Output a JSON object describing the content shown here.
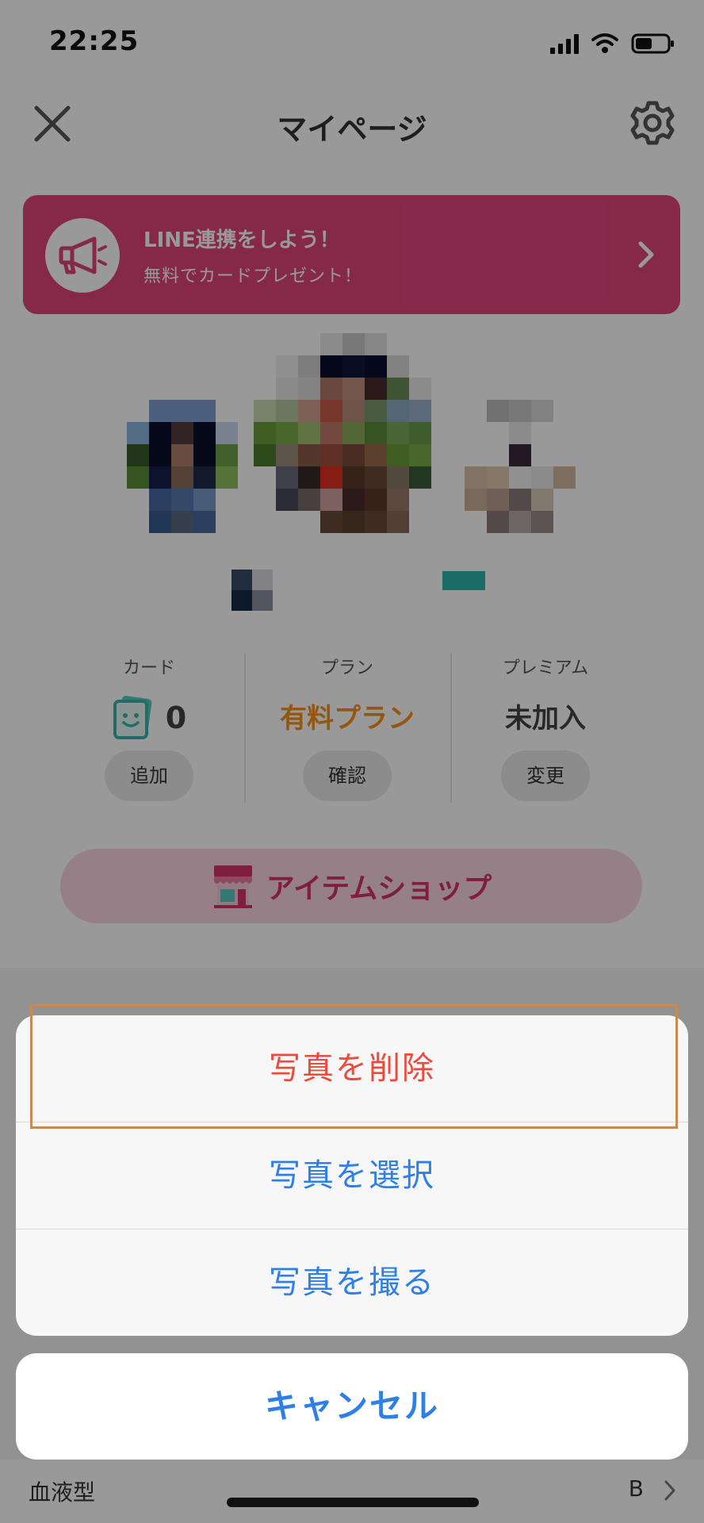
{
  "status_bar": {
    "time": "22:25"
  },
  "header": {
    "title": "マイページ",
    "close_icon": "close-icon",
    "settings_icon": "gear-icon"
  },
  "banner": {
    "title": "LINE連携をしよう！",
    "subtitle": "無料でカードプレゼント！",
    "icon": "megaphone-icon",
    "color": "#e0457b"
  },
  "stats": {
    "card": {
      "label": "カード",
      "value": "0",
      "button": "追加",
      "icon": "card-icon"
    },
    "plan": {
      "label": "プラン",
      "value": "有料プラン",
      "button": "確認",
      "value_color": "#f5911e"
    },
    "premium": {
      "label": "プレミアム",
      "value": "未加入",
      "button": "変更"
    }
  },
  "item_shop": {
    "label": "アイテムショップ",
    "icon": "item-shop-icon",
    "color": "#d4326a"
  },
  "profile_rows": [
    {
      "label": "血液型",
      "value": "B"
    }
  ],
  "action_sheet": {
    "actions": [
      {
        "label": "写真を削除",
        "style": "destructive"
      },
      {
        "label": "写真を選択",
        "style": "default"
      },
      {
        "label": "写真を撮る",
        "style": "default"
      }
    ],
    "cancel_label": "キャンセル",
    "accent": "#2f80e6",
    "destructive_color": "#eb4b3e"
  }
}
